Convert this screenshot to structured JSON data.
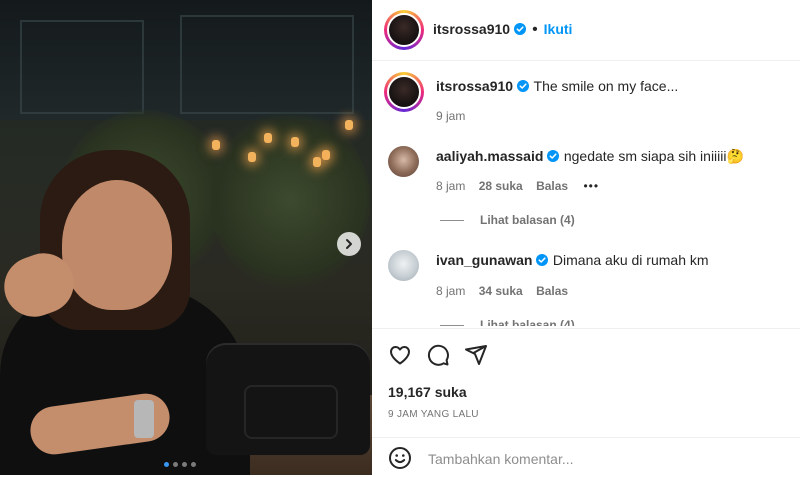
{
  "header": {
    "username": "itsrossa910",
    "separator": "•",
    "follow_label": "Ikuti"
  },
  "caption": {
    "username": "itsrossa910",
    "text": "The smile on my face...",
    "time": "9 jam"
  },
  "comments": [
    {
      "username": "aaliyah.massaid",
      "text": "ngedate sm siapa sih iniiiii🤔",
      "time": "8 jam",
      "likes": "28 suka",
      "reply_label": "Balas",
      "more": "•••",
      "view_replies": "Lihat balasan (4)"
    },
    {
      "username": "ivan_gunawan",
      "text": "Dimana aku di rumah km",
      "time": "8 jam",
      "likes": "34 suka",
      "reply_label": "Balas",
      "view_replies": "Lihat balasan (4)"
    }
  ],
  "stats": {
    "likes": "19,167 suka",
    "time_ago": "9 JAM YANG LALU"
  },
  "add_comment": {
    "placeholder": "Tambahkan komentar..."
  },
  "icons": {
    "like": "heart-icon",
    "comment": "comment-icon",
    "share": "share-icon",
    "emoji": "emoji-icon",
    "next": "chevron-right-icon",
    "verified": "verified-badge-icon"
  },
  "colors": {
    "accent": "#0095f6",
    "verified": "#0095f6",
    "text": "#262626",
    "muted": "#737373"
  }
}
